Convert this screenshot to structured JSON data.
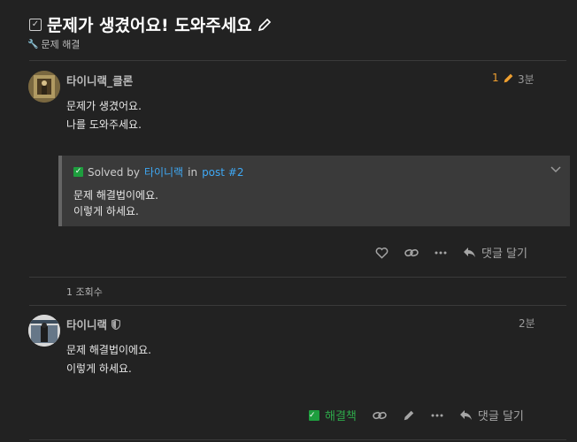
{
  "topic": {
    "title": "문제가 생겼어요! 도와주세요",
    "category": "문제 해결"
  },
  "post1": {
    "username": "타이니랙_클론",
    "edit_count": "1",
    "time": "3분",
    "lines": [
      "문제가 생겼어요.",
      "나를 도와주세요."
    ],
    "solved": {
      "label": "Solved by",
      "by": "타이니랙",
      "in": "in",
      "post_link": "post #2",
      "lines": [
        "문제 해결법이에요.",
        "이렇게 하세요."
      ]
    },
    "reply_label": "댓글 달기"
  },
  "views": "1 조회수",
  "post2": {
    "username": "타이니랙",
    "time": "2분",
    "lines": [
      "문제 해결법이에요.",
      "이렇게 하세요."
    ],
    "solution_label": "해결책",
    "reply_label": "댓글 달기"
  }
}
